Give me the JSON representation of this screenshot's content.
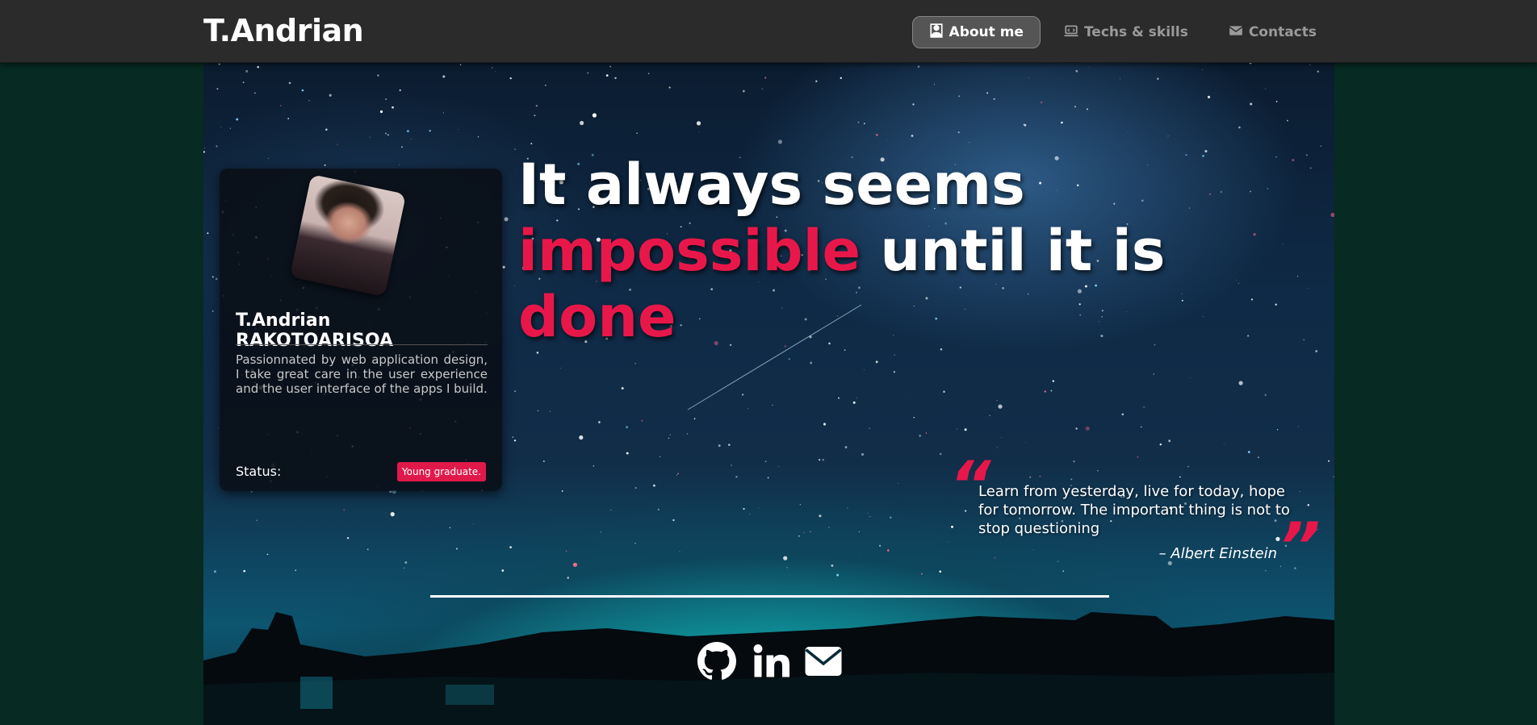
{
  "brand": "T.Andrian",
  "nav": {
    "items": [
      {
        "label": "About me",
        "icon": "user-tie-icon",
        "active": true
      },
      {
        "label": "Techs & skills",
        "icon": "laptop-code-icon",
        "active": false
      },
      {
        "label": "Contacts",
        "icon": "envelope-icon",
        "active": false
      }
    ]
  },
  "profile": {
    "name": "T.Andrian RAKOTOARISOA",
    "bio": "Passionnated by web application design, I take great care in the user experience and the user interface of the apps I build.",
    "status_label": "Status:",
    "status_badge": "Young graduate."
  },
  "headline": {
    "part1": "It always seems ",
    "accent1": "impossible",
    "part2": " until it is ",
    "accent2": "done"
  },
  "quote": {
    "open_mark": "“",
    "text": "Learn from yesterday, live for today, hope for tomorrow. The important thing is not to stop questioning",
    "author": "–  Albert Einstein",
    "close_mark": "”"
  },
  "socials": [
    {
      "icon": "github-icon"
    },
    {
      "icon": "linkedin-icon"
    },
    {
      "icon": "envelope-icon"
    }
  ],
  "colors": {
    "accent": "#e8174a",
    "navbar": "#2b2b2b",
    "page_bg": "#072a22"
  }
}
